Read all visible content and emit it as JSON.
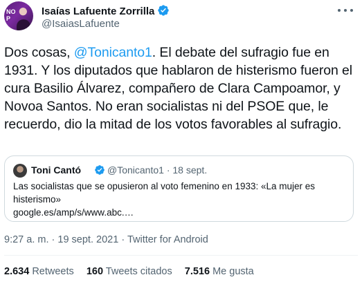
{
  "author": {
    "name": "Isaías Lafuente Zorrilla",
    "handle": "@IsaiasLafuente"
  },
  "tweet": {
    "text_start": "Dos cosas, ",
    "mention": "@Tonicanto1",
    "text_rest": ". El debate del sufragio fue en 1931. Y los diputados que hablaron de histerismo fueron el cura Basilio Álvarez, compañero de Clara Campoamor, y Novoa Santos. No eran socialistas ni del PSOE que, le recuerdo, dio la mitad de los votos favorables al sufragio."
  },
  "quote": {
    "name": "Toni Cantó",
    "handle": "@Tonicanto1",
    "separator": "·",
    "date": "18 sept.",
    "text": "Las socialistas que se opusieron al voto femenino en 1933: «La mujer es histerismo»",
    "link": "google.es/amp/s/www.abc.…"
  },
  "meta": {
    "time": "9:27 a. m.",
    "separator": "·",
    "date": "19 sept. 2021",
    "source": "Twitter for Android"
  },
  "stats": {
    "retweets_count": "2.634",
    "retweets_label": "Retweets",
    "quotes_count": "160",
    "quotes_label": "Tweets citados",
    "likes_count": "7.516",
    "likes_label": "Me gusta"
  },
  "colors": {
    "accent": "#1d9bf0",
    "secondary_text": "#536471",
    "border": "#cfd9de"
  }
}
